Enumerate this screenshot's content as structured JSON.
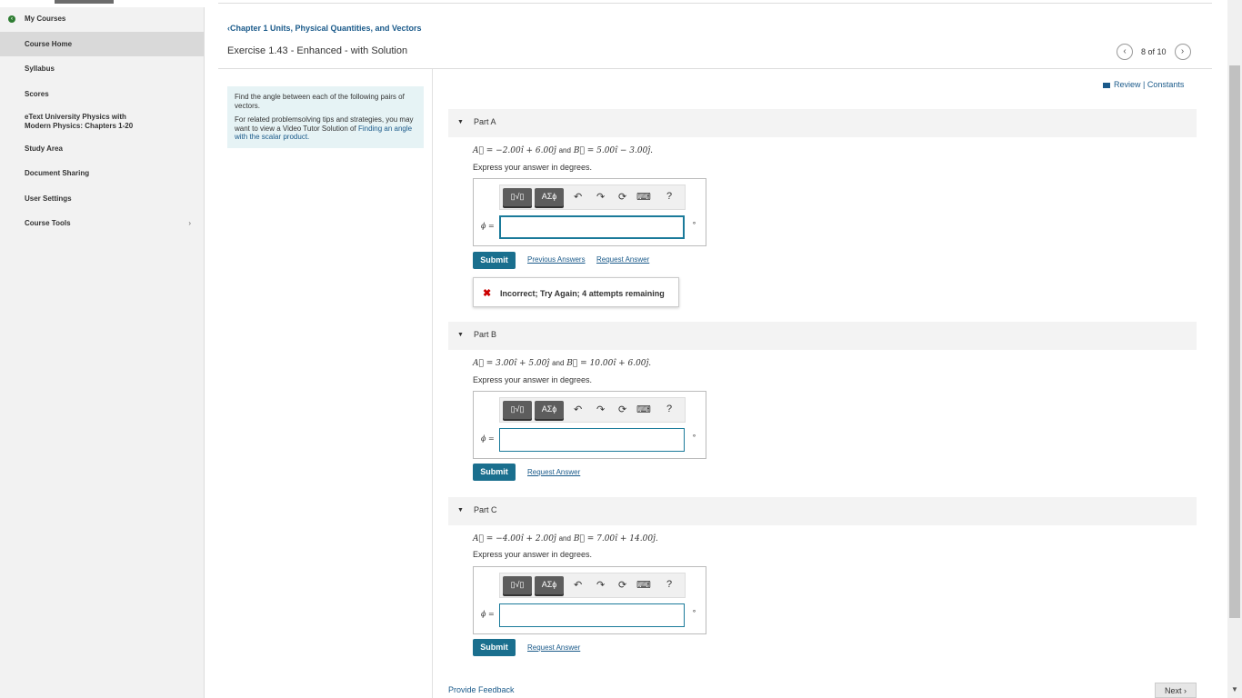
{
  "sidebar": {
    "my_courses": "My Courses",
    "items": [
      {
        "label": "Course Home"
      },
      {
        "label": "Syllabus"
      },
      {
        "label": "Scores"
      },
      {
        "label": "eText University Physics with Modern Physics: Chapters 1-20"
      },
      {
        "label": "Study Area"
      },
      {
        "label": "Document Sharing"
      },
      {
        "label": "User Settings"
      },
      {
        "label": "Course Tools"
      }
    ]
  },
  "header": {
    "chapter_link": "Chapter 1 Units, Physical Quantities, and Vectors",
    "exercise_title": "Exercise 1.43 - Enhanced - with Solution",
    "pager_count": "8 of 10",
    "review_label": "Review",
    "constants_label": "Constants",
    "separator": "|"
  },
  "intro": {
    "line1": "Find the angle between each of the following pairs of vectors.",
    "line2": "For related problemsolving tips and strategies, you may want to view a Video Tutor Solution of",
    "link": "Finding an angle with the scalar product."
  },
  "parts": [
    {
      "label": "Part A",
      "eq_a": "A⃗ = −2.00î + 6.00ĵ",
      "and": "and",
      "eq_b": "B⃗ = 5.00î − 3.00ĵ.",
      "instruction": "Express your answer in degrees.",
      "phi_label": "ϕ =",
      "answer_value": "",
      "degree": "∘",
      "submit": "Submit",
      "prev_answers": "Previous Answers",
      "request_answer": "Request Answer",
      "feedback": "Incorrect; Try Again; 4 attempts remaining"
    },
    {
      "label": "Part B",
      "eq_a": "A⃗ = 3.00î + 5.00ĵ",
      "and": "and",
      "eq_b": "B⃗ = 10.00î + 6.00ĵ.",
      "instruction": "Express your answer in degrees.",
      "phi_label": "ϕ =",
      "answer_value": "",
      "degree": "∘",
      "submit": "Submit",
      "request_answer": "Request Answer"
    },
    {
      "label": "Part C",
      "eq_a": "A⃗ = −4.00î + 2.00ĵ",
      "and": "and",
      "eq_b": "B⃗ = 7.00î + 14.00ĵ.",
      "instruction": "Express your answer in degrees.",
      "phi_label": "ϕ =",
      "answer_value": "",
      "degree": "∘",
      "submit": "Submit",
      "request_answer": "Request Answer"
    }
  ],
  "toolbar": {
    "template_btn": "▯√▯",
    "symbols_btn": "ΑΣϕ",
    "undo": "↶",
    "redo": "↷",
    "reset": "⟳",
    "keyboard": "⌨",
    "help": "?"
  },
  "footer": {
    "provide_feedback": "Provide Feedback",
    "next": "Next ›"
  }
}
